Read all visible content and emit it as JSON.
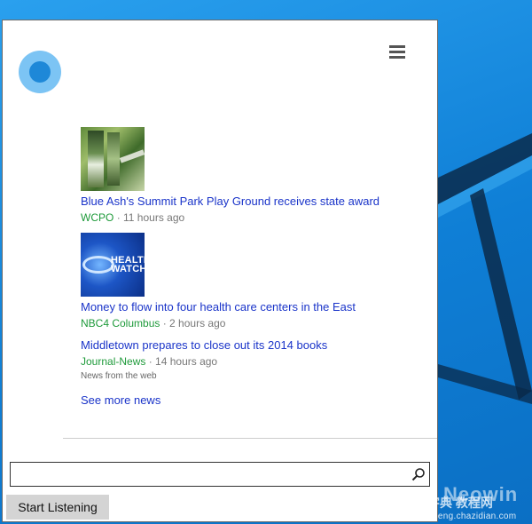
{
  "colors": {
    "accent": "#1e88d8",
    "link": "#1a34c9",
    "source": "#1e9a3a",
    "meta": "#777777"
  },
  "icons": {
    "assistant": "cortana-ring-icon",
    "menu": "hamburger-icon",
    "search": "search-icon"
  },
  "news": {
    "items": [
      {
        "headline": "Blue Ash's Summit Park Play Ground receives state award",
        "source": "WCPO",
        "age": "· 11 hours ago",
        "thumb_text": ""
      },
      {
        "headline": "Money to flow into four health care centers in the East",
        "source": "NBC4 Columbus",
        "age": "· 2 hours ago",
        "thumb_text": "HEALTH WATCH"
      },
      {
        "headline": "Middletown prepares to close out its 2014 books",
        "source": "Journal-News",
        "age": "· 14 hours ago"
      }
    ],
    "footer_note": "News from the web",
    "see_more": "See more news"
  },
  "search": {
    "value": "",
    "placeholder": ""
  },
  "start_listening": "Start Listening",
  "watermark": {
    "brand": "Neowin",
    "cn": "查字典",
    "cn2": "教程网",
    "url": "jiaocheng.chazidian.com"
  }
}
